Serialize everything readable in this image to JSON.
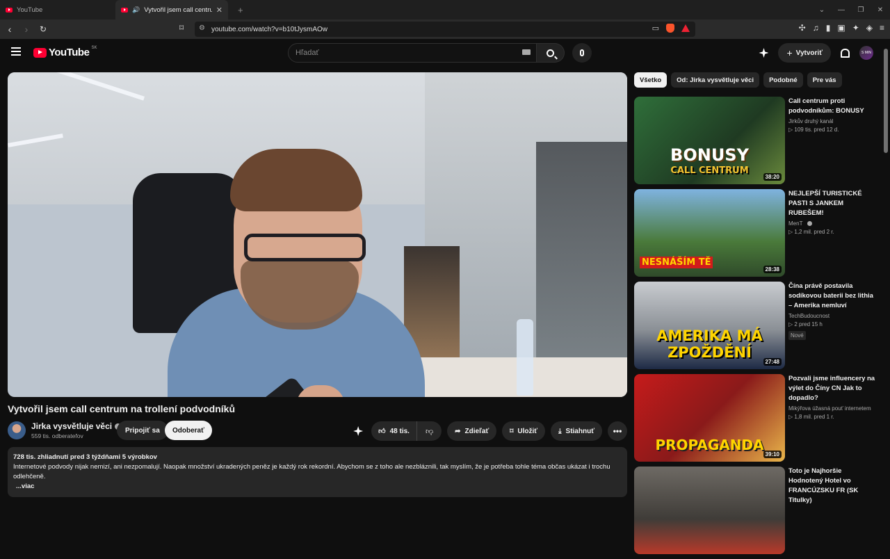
{
  "browser": {
    "tabs": [
      {
        "title": "YouTube",
        "active": false
      },
      {
        "title": "Vytvořil jsem call centrum na",
        "active": true
      }
    ],
    "url": "youtube.com/watch?v=b10tJysmAOw"
  },
  "header": {
    "logo": "YouTube",
    "country": "SK",
    "search_placeholder": "Hľadať",
    "create_label": "Vytvoriť",
    "avatar_text": "S MIN"
  },
  "video": {
    "title": "Vytvořil jsem call centrum na trollení podvodníků",
    "channel": "Jirka vysvětluje věci",
    "subscribers": "559 tis. odberateľov",
    "join_label": "Pripojiť sa",
    "subscribe_label": "Odoberať",
    "likes": "48 tis.",
    "share_label": "Zdieľať",
    "save_label": "Uložiť",
    "download_label": "Stiahnuť",
    "more_label": "•••",
    "description": {
      "meta": "728 tis. zhliadnutí  pred 3 týždňami  5 výrobkov",
      "text": "Internetové podvody nijak nemizí, ani nezpomalují. Naopak množství ukradených peněz je každý rok rekordní. Abychom se z toho ale nezbláznili, tak myslím, že je potřeba tohle téma občas ukázat i trochu odlehčeně.",
      "more": "...viac"
    }
  },
  "sidebar": {
    "chips": [
      "Všetko",
      "Od: Jirka vysvětluje věci",
      "Podobné",
      "Pre vás"
    ],
    "recommendations": [
      {
        "title": "Call centrum proti podvodníkům: BONUSY",
        "channel": "Jirkův druhý kanál",
        "stats": "▷ 109 tis.   pred 12 d.",
        "duration": "38:20",
        "caption": "BONUSY",
        "caption2": "CALL CENTRUM",
        "badge": ""
      },
      {
        "title": "NEJLEPŠÍ TURISTICKÉ PASTI S JANKEM RUBEŠEM!",
        "channel": "MenT",
        "stats": "▷ 1,2 mil.   pred 2 r.",
        "duration": "28:38",
        "caption": "NESNÁŠÍM TĚ",
        "caption2": "",
        "badge": ""
      },
      {
        "title": "Čína právě postavila sodíkovou baterii bez lithia – Amerika nemluví",
        "channel": "TechBudoucnost",
        "stats": "▷ 2   pred 15 h",
        "duration": "27:48",
        "caption": "AMERIKA MÁ ZPOŽDĚNÍ",
        "caption2": "",
        "badge": "Nové"
      },
      {
        "title": "Pozvali jsme influencery na výlet do Číny CN Jak to dopadlo?",
        "channel": "Mikýřova úžasná pouť internetem",
        "stats": "▷ 1,8 mil.   pred 1 r.",
        "duration": "39:10",
        "caption": "PROPAGANDA",
        "caption2": "",
        "badge": ""
      },
      {
        "title": "Toto je Najhoršie Hodnotený Hotel vo FRANCÚZSKU FR (SK Titulky)",
        "channel": "",
        "stats": "",
        "duration": "",
        "caption": "",
        "caption2": "",
        "badge": ""
      }
    ]
  },
  "colors": {
    "brand": "#ff0033",
    "bg": "#0f0f0f",
    "surface": "#272727"
  }
}
